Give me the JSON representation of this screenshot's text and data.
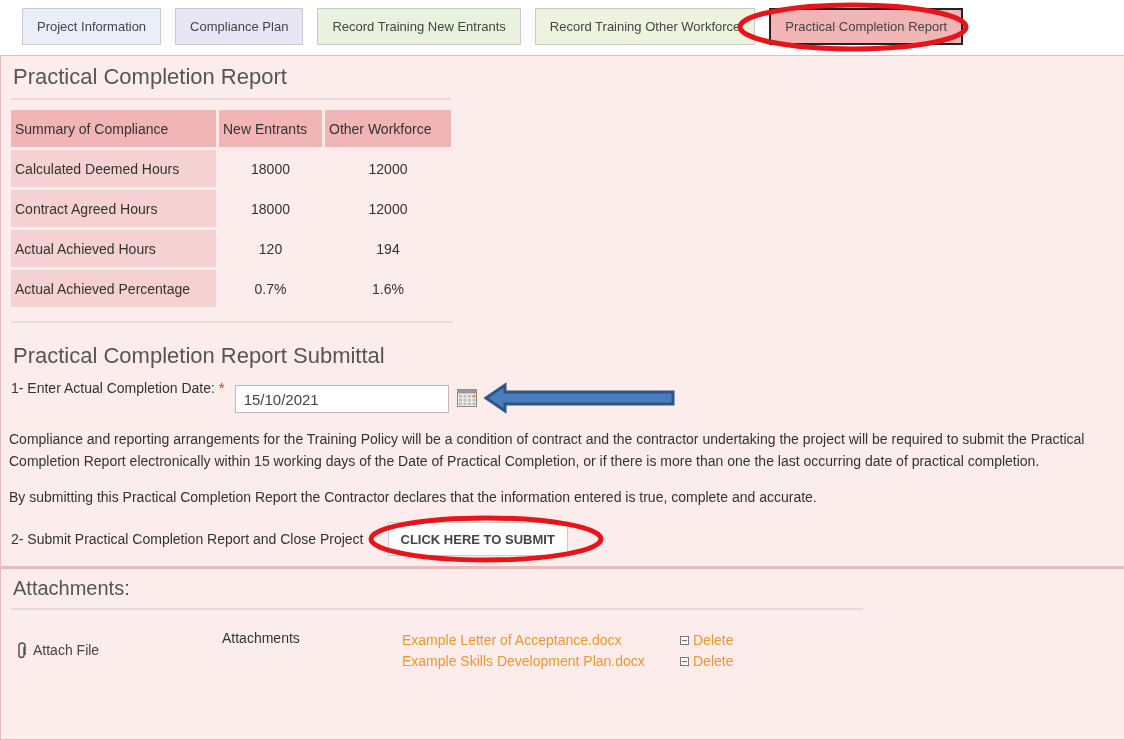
{
  "tabs": [
    {
      "label": "Project Information",
      "selected": false,
      "color": "#e9eef9",
      "circled": false
    },
    {
      "label": "Compliance Plan",
      "selected": false,
      "color": "#e8e6f4",
      "circled": false
    },
    {
      "label": "Record Training New Entrants",
      "selected": false,
      "color": "#e8f2df",
      "circled": false
    },
    {
      "label": "Record Training Other Workforce",
      "selected": false,
      "color": "#eef3df",
      "circled": false
    },
    {
      "label": "Practical Completion Report",
      "selected": true,
      "color": "#f1b5b5",
      "circled": true
    }
  ],
  "report": {
    "title": "Practical Completion Report",
    "table": {
      "columns": [
        "Summary of Compliance",
        "New Entrants",
        "Other Workforce"
      ],
      "rows": [
        [
          "Calculated Deemed Hours",
          "18000",
          "12000"
        ],
        [
          "Contract Agreed Hours",
          "18000",
          "12000"
        ],
        [
          "Actual Achieved Hours",
          "120",
          "194"
        ],
        [
          "Actual Achieved Percentage",
          "0.7%",
          "1.6%"
        ]
      ]
    }
  },
  "submittal": {
    "title": "Practical Completion Report Submittal",
    "date_label": "1- Enter Actual Completion Date:",
    "required_mark": "*",
    "date_value": "15/10/2021",
    "date_arrow": true,
    "paragraphs": [
      "Compliance and reporting arrangements for the Training Policy will be a condition of contract and the contractor undertaking the project will be required to submit the Practical Completion Report electronically within 15 working days of the Date of Practical Completion, or if there is more than one the last occurring date of practical completion.",
      "By submitting this Practical Completion Report the Contractor declares that the information entered is true, complete and accurate."
    ],
    "submit_label": "2- Submit Practical Completion Report and Close Project",
    "submit_button": "CLICK HERE TO SUBMIT",
    "submit_circled": true
  },
  "attachments": {
    "title": "Attachments:",
    "attach_label": "Attach File",
    "column": "Attachments",
    "files": [
      {
        "name": "Example Letter of Acceptance.docx",
        "action": "Delete"
      },
      {
        "name": "Example Skills Development Plan.docx",
        "action": "Delete"
      }
    ]
  }
}
